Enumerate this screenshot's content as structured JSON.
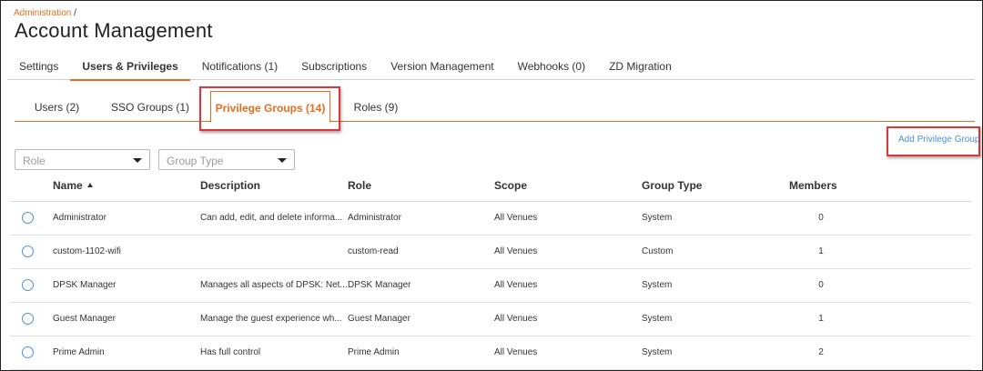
{
  "breadcrumb": {
    "root": "Administration",
    "separator": " /"
  },
  "page": {
    "title": "Account Management"
  },
  "main_tabs": [
    {
      "label": "Settings"
    },
    {
      "label": "Users & Privileges"
    },
    {
      "label": "Notifications (1)"
    },
    {
      "label": "Subscriptions"
    },
    {
      "label": "Version Management"
    },
    {
      "label": "Webhooks (0)"
    },
    {
      "label": "ZD Migration"
    }
  ],
  "sub_tabs": [
    {
      "label": "Users (2)"
    },
    {
      "label": "SSO Groups (1)"
    },
    {
      "label": "Privilege Groups (14)"
    },
    {
      "label": "Roles (9)"
    }
  ],
  "toolbar": {
    "add_label": "Add Privilege Group"
  },
  "filters": {
    "role_placeholder": "Role",
    "group_type_placeholder": "Group Type"
  },
  "table": {
    "headers": {
      "name": "Name",
      "description": "Description",
      "role": "Role",
      "scope": "Scope",
      "group_type": "Group Type",
      "members": "Members"
    },
    "rows": [
      {
        "name": "Administrator",
        "description": "Can add, edit, and delete informa...",
        "role": "Administrator",
        "scope": "All Venues",
        "group_type": "System",
        "members": "0"
      },
      {
        "name": "custom-1102-wifi",
        "description": "",
        "role": "custom-read",
        "scope": "All Venues",
        "group_type": "Custom",
        "members": "1"
      },
      {
        "name": "DPSK Manager",
        "description": "Manages all aspects of DPSK: Net...",
        "role": "DPSK Manager",
        "scope": "All Venues",
        "group_type": "System",
        "members": "0"
      },
      {
        "name": "Guest Manager",
        "description": "Manage the guest experience wh...",
        "role": "Guest Manager",
        "scope": "All Venues",
        "group_type": "System",
        "members": "1"
      },
      {
        "name": "Prime Admin",
        "description": "Has full control",
        "role": "Prime Admin",
        "scope": "All Venues",
        "group_type": "System",
        "members": "2"
      }
    ]
  },
  "colors": {
    "accent": "#e56d1f",
    "link": "#4a90d9",
    "highlight": "#d9383a"
  }
}
